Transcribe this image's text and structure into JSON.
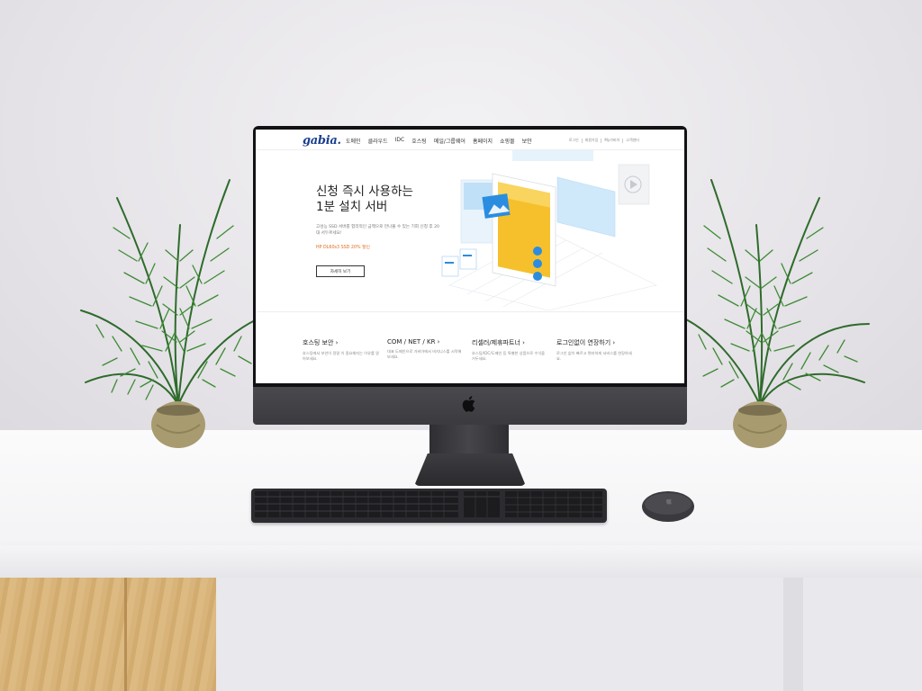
{
  "site": {
    "logo": "gabia.",
    "nav": [
      "도메인",
      "클라우드",
      "IDC",
      "호스팅",
      "메일/그룹웨어",
      "홈페이지",
      "쇼핑몰",
      "보안"
    ],
    "utility": [
      "로그인",
      "회원가입",
      "My가비아",
      "고객센터"
    ]
  },
  "hero": {
    "title_line1": "신청 즉시 사용하는",
    "title_line2": "1분 설치 서버",
    "description": "고성능 SSD 서버를 합리적인 금액으로 만나볼 수 있는 기회 신청 후 20대 서두르세요!",
    "promo": "HP DL60s3 SSD 20% 할인",
    "button": "자세히 보기"
  },
  "features": [
    {
      "title": "호스팅 보안 ›",
      "desc": "호스팅에서 보안이 정말 이 중요해지는 이유를 알아보세요."
    },
    {
      "title": "COM / NET / KR ›",
      "desc": "대표 도메인으로 가비아에서 비지니스를 시작해보세요."
    },
    {
      "title": "리셀러/제휴파트너 ›",
      "desc": "호스팅/IDC/도메인 등 특별한 상품으로 수익을 거두세요."
    },
    {
      "title": "로그인없이 연장하기 ›",
      "desc": "로그인 없이 빠르고 편리하게 서비스를 연장하세요."
    }
  ],
  "colors": {
    "logo": "#1b3f8f",
    "promo": "#e06b1f",
    "accent_yellow": "#f6c02c",
    "accent_blue": "#2a8de0"
  },
  "icons": {
    "monitor_logo": "apple-logo-icon"
  }
}
